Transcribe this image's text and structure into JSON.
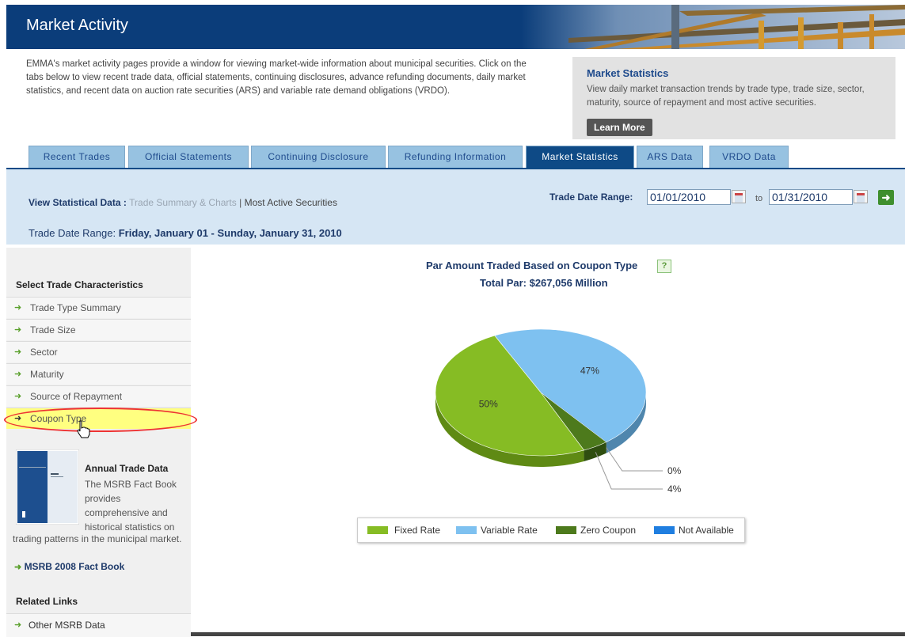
{
  "header": {
    "title": "Market Activity"
  },
  "intro": {
    "text": "EMMA's market activity pages provide a window for viewing market-wide information about municipal securities. Click on the tabs below to view recent trade data, official statements, continuing disclosures, advance refunding documents, daily market statistics, and recent data on auction rate securities (ARS) and variable rate demand obligations (VRDO)."
  },
  "stats_box": {
    "title": "Market Statistics",
    "desc": "View daily market transaction trends by trade type, trade size, sector, maturity, source of repayment and most active securities.",
    "button": "Learn More"
  },
  "tabs": [
    {
      "label": "Recent Trades"
    },
    {
      "label": "Official Statements"
    },
    {
      "label": "Continuing Disclosure"
    },
    {
      "label": "Refunding Information"
    },
    {
      "label": "Market Statistics"
    },
    {
      "label": "ARS Data"
    },
    {
      "label": "VRDO Data"
    }
  ],
  "filter": {
    "view_label": "View Statistical Data :",
    "view_link1": "Trade Summary & Charts",
    "view_sep": "|",
    "view_link2": "Most Active Securities",
    "range_label": "Trade Date Range:",
    "from_date": "01/01/2010",
    "to_label": "to",
    "to_date": "01/31/2010",
    "trade_date_range_label": "Trade Date Range:",
    "trade_date_range_value": "Friday, January 01 - Sunday, January 31, 2010"
  },
  "sidebar": {
    "heading": "Select Trade Characteristics",
    "items": [
      {
        "label": "Trade Type Summary"
      },
      {
        "label": "Trade Size"
      },
      {
        "label": "Sector"
      },
      {
        "label": "Maturity"
      },
      {
        "label": "Source of Repayment"
      },
      {
        "label": "Coupon Type"
      }
    ],
    "annual_title": "Annual Trade Data",
    "annual_desc1": "The MSRB Fact Book provides comprehensive and historical statistics on",
    "annual_desc2": "trading patterns in the municipal market.",
    "fact_book_link": "MSRB 2008 Fact Book",
    "related_heading": "Related Links",
    "related_item": "Other MSRB Data"
  },
  "chart": {
    "title": "Par Amount Traded Based on Coupon Type",
    "help": "?",
    "subtitle": "Total Par:  $267,056 Million"
  },
  "chart_data": {
    "type": "pie",
    "categories": [
      "Fixed Rate",
      "Variable Rate",
      "Zero Coupon",
      "Not Available"
    ],
    "values": [
      50,
      47,
      4,
      0
    ],
    "labels": [
      "50%",
      "47%",
      "4%",
      "0%"
    ],
    "colors": [
      "#86bc24",
      "#7ec1f0",
      "#4d7a1c",
      "#1f7ee0"
    ],
    "title": "Par Amount Traded Based on Coupon Type",
    "subtitle": "Total Par:  $267,056 Million",
    "legend_position": "bottom"
  }
}
